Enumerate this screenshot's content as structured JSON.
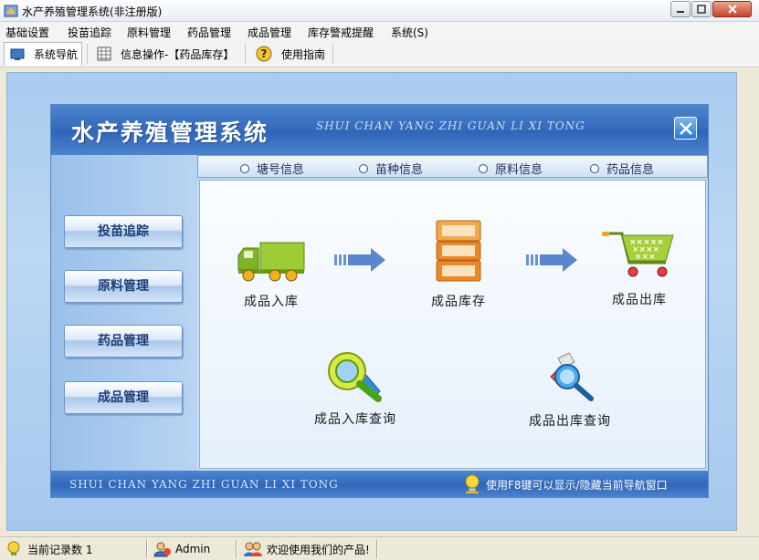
{
  "window": {
    "title": "水产养殖管理系统(非注册版)"
  },
  "menu": [
    {
      "label": "基础设置"
    },
    {
      "label": "投苗追踪"
    },
    {
      "label": "原料管理"
    },
    {
      "label": "药品管理"
    },
    {
      "label": "成品管理"
    },
    {
      "label": "库存警戒提醒"
    },
    {
      "label": "系统(S)"
    }
  ],
  "toolbar": {
    "nav_label": "系统导航",
    "info_label": "信息操作-【药品库存】",
    "guide_label": "使用指南"
  },
  "panel": {
    "title": "水产养殖管理系统",
    "subtitle": "SHUI CHAN YANG ZHI GUAN LI XI TONG",
    "tabs": [
      {
        "label": "塘号信息"
      },
      {
        "label": "苗种信息"
      },
      {
        "label": "原料信息"
      },
      {
        "label": "药品信息"
      }
    ],
    "side_buttons": [
      {
        "label": "投苗追踪"
      },
      {
        "label": "原料管理"
      },
      {
        "label": "药品管理"
      },
      {
        "label": "成品管理"
      }
    ],
    "features": {
      "inbound": "成品入库",
      "stock": "成品库存",
      "outbound": "成品出库",
      "inbound_query": "成品入库查询",
      "outbound_query": "成品出库查询"
    },
    "footer_brand": "SHUI CHAN YANG ZHI GUAN LI XI TONG",
    "footer_hint": "使用F8键可以显示/隐藏当前导航窗口"
  },
  "statusbar": {
    "records": "当前记录数 1",
    "user": "Admin",
    "welcome": "欢迎使用我们的产品!"
  },
  "colors": {
    "header_blue": "#2f66b9",
    "workspace_blue": "#a9cbef",
    "truck_green": "#8bc12a",
    "barrel_orange": "#e87b1e"
  }
}
